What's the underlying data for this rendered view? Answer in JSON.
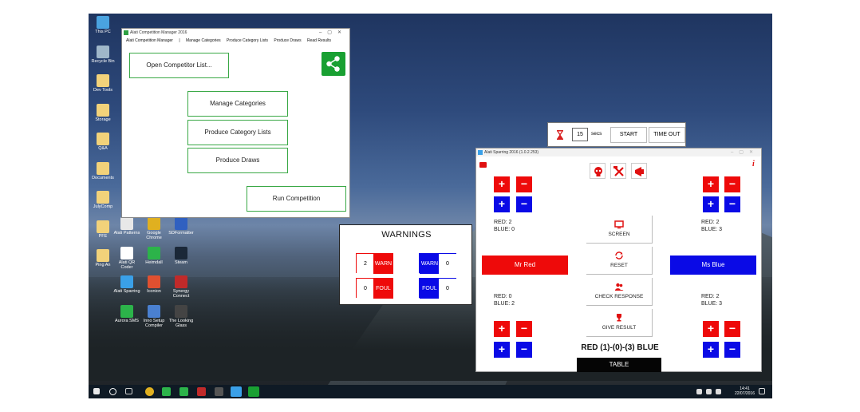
{
  "desktop": {
    "icons": [
      {
        "label": "This PC",
        "color": "#4aa3e0"
      },
      {
        "label": "Recycle Bin",
        "color": "#9fb7c9"
      },
      {
        "label": "Dev Tools",
        "color": "#f2d27a"
      },
      {
        "label": "Storage",
        "color": "#f2d27a"
      },
      {
        "label": "Q&A",
        "color": "#f2d27a"
      },
      {
        "label": "Documents",
        "color": "#f2d27a"
      },
      {
        "label": "JulyComp",
        "color": "#f2d27a"
      },
      {
        "label": "PFE",
        "color": "#f2d27a"
      },
      {
        "label": "Ping An",
        "color": "#f2d27a"
      },
      {
        "label": "Alati Patterns",
        "color": "#e8e8e8"
      },
      {
        "label": "Alati QR Coder",
        "color": "#ffffff"
      },
      {
        "label": "Alati Sparring",
        "color": "#3aa0e8"
      },
      {
        "label": "Aurora SMS",
        "color": "#2cb34a"
      },
      {
        "label": "Google Chrome",
        "color": "#e0b020"
      },
      {
        "label": "Heimdall",
        "color": "#2cb34a"
      },
      {
        "label": "Iconion",
        "color": "#e05030"
      },
      {
        "label": "Inno Setup Compiler",
        "color": "#4a80d0"
      },
      {
        "label": "SDFormatter",
        "color": "#3060c0"
      },
      {
        "label": "Steam",
        "color": "#1b2838"
      },
      {
        "label": "Synergy Connect",
        "color": "#c02a2a"
      },
      {
        "label": "The Looking Glass",
        "color": "#444444"
      }
    ]
  },
  "taskbar": {
    "time": "14:41",
    "date": "22/07/2016"
  },
  "manager": {
    "title": "Alati Competition Manager 2016",
    "menu": [
      "Alati Competition Manager",
      "|",
      "Manage Categories",
      "Produce Category Lists",
      "Produce Draws",
      "Read Results"
    ],
    "open_list": "Open Competitor List...",
    "manage_categories": "Manage Categories",
    "produce_lists": "Produce Category Lists",
    "produce_draws": "Produce Draws",
    "run_competition": "Run Competition"
  },
  "timer": {
    "seconds": "15",
    "secs_label": "secs",
    "start": "START",
    "timeout": "TIME OUT"
  },
  "warnings": {
    "title": "WARNINGS",
    "red_warn_count": "2",
    "red_warn_label": "WARN",
    "red_foul_count": "0",
    "red_foul_label": "FOUL",
    "blue_warn_label": "WARN",
    "blue_warn_count": "0",
    "blue_foul_label": "FOUL",
    "blue_foul_count": "0"
  },
  "sparring": {
    "title": "Alati Sparring 2016 (1.0.2.253)",
    "left_top_score": {
      "red": "RED: 2",
      "blue": "BLUE: 0"
    },
    "right_top_score": {
      "red": "RED: 2",
      "blue": "BLUE: 3"
    },
    "left_bottom_score": {
      "red": "RED: 0",
      "blue": "BLUE: 2"
    },
    "right_bottom_score": {
      "red": "RED: 2",
      "blue": "BLUE: 3"
    },
    "red_name": "Mr Red",
    "blue_name": "Ms Blue",
    "screen": "SCREEN",
    "reset": "RESET",
    "check_response": "CHECK RESPONSE",
    "give_result": "GIVE RESULT",
    "result": "RED (1)-(0)-(3) BLUE",
    "table": "TABLE",
    "plus": "+",
    "minus": "−",
    "info": "i"
  },
  "colors": {
    "red": "#ee0a0a",
    "blue": "#0a0ae6",
    "green": "#39a845"
  }
}
